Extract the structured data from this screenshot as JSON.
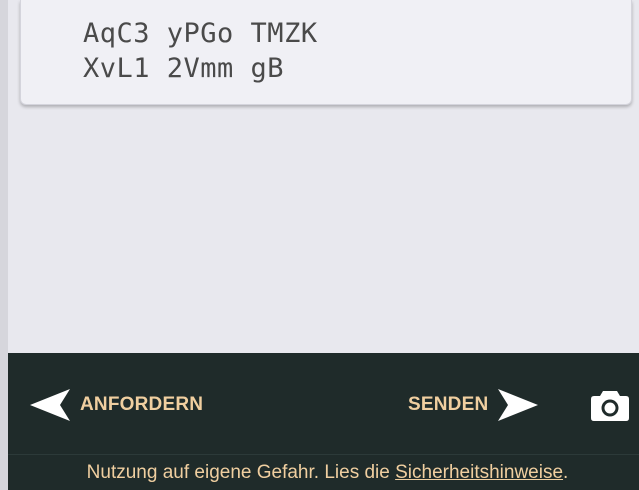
{
  "key": {
    "line1": "AqC3 yPGo TMZK",
    "line2": "XvL1 2Vmm gB"
  },
  "actions": {
    "request_label": "ANFORDERN",
    "send_label": "SENDEN",
    "request_icon": "arrow-left-icon",
    "send_icon": "arrow-right-icon",
    "camera_icon": "camera-icon"
  },
  "footer": {
    "text_before": "Nutzung auf eigene Gefahr. Lies die ",
    "link_text": "Sicherheitshinweise",
    "text_after": "."
  },
  "colors": {
    "accent": "#f0cfa0",
    "bar_background": "#1f2b2a",
    "content_background": "#e8e8ee"
  }
}
